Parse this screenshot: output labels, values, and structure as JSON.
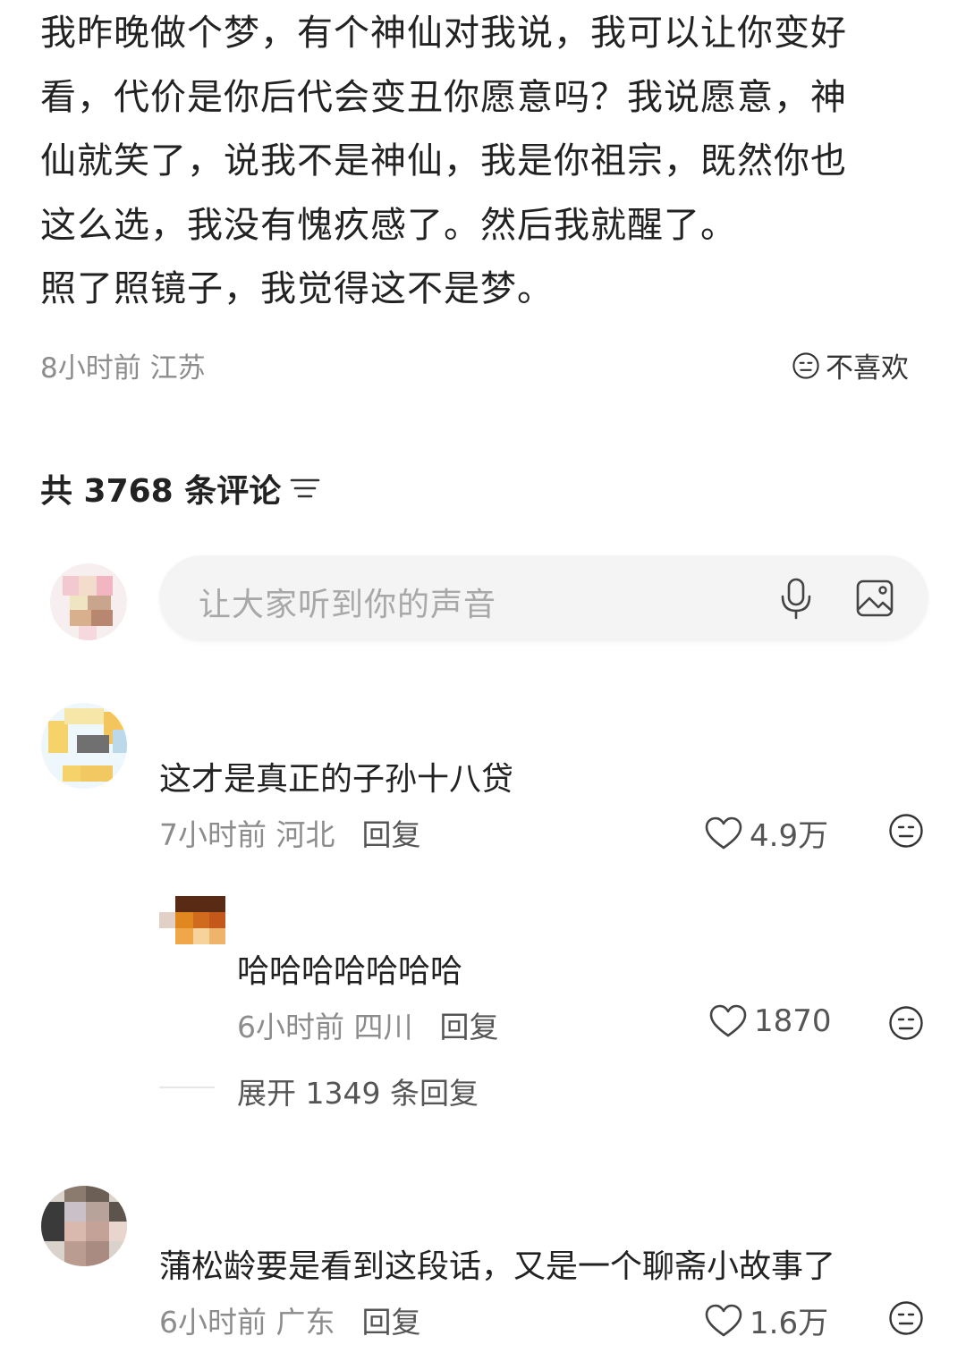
{
  "post": {
    "lines": [
      "我昨晚做个梦，有个神仙对我说，我可以让你变好",
      "看，代价是你后代会变丑你愿意吗？我说愿意，神",
      "仙就笑了，说我不是神仙，我是你祖宗，既然你也",
      "这么选，我没有愧疚感了。然后我就醒了。",
      "照了照镜子，我觉得这不是梦。"
    ],
    "time_location": "8小时前 江苏",
    "dislike_label": "不喜欢"
  },
  "comments_header": {
    "title": "共 3768 条评论"
  },
  "input": {
    "placeholder": "让大家听到你的声音"
  },
  "comments": [
    {
      "text": "这才是真正的子孙十八贷",
      "time_location": "7小时前 河北",
      "reply_label": "回复",
      "likes": "4.9万",
      "replies": [
        {
          "text": "哈哈哈哈哈哈哈",
          "time_location": "6小时前 四川",
          "reply_label": "回复",
          "likes": "1870"
        }
      ],
      "expand_label": "展开 1349 条回复"
    },
    {
      "text": "蒲松龄要是看到这段话，又是一个聊斋小故事了",
      "time_location": "6小时前 广东",
      "reply_label": "回复",
      "likes": "1.6万"
    }
  ],
  "icons": {
    "dislike": "neutral-face-icon",
    "sort": "sort-lines-icon",
    "mic": "microphone-icon",
    "image": "image-icon",
    "like": "heart-outline-icon"
  }
}
